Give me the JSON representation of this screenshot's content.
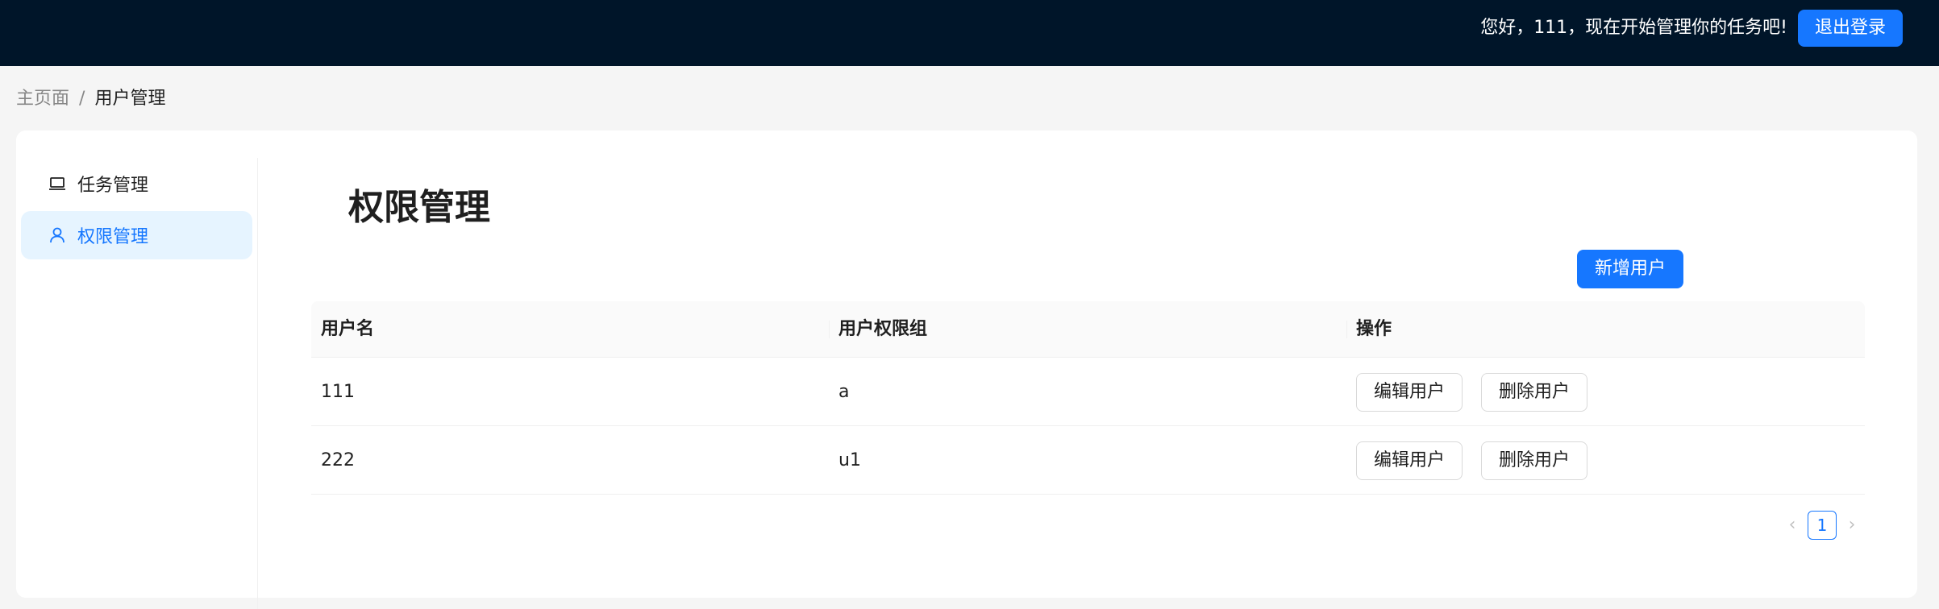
{
  "header": {
    "greeting": "您好，111，现在开始管理你的任务吧!",
    "logout_label": "退出登录"
  },
  "breadcrumb": {
    "home": "主页面",
    "separator": "/",
    "current": "用户管理"
  },
  "sidebar": {
    "items": [
      {
        "label": "任务管理",
        "icon": "laptop-icon",
        "active": false
      },
      {
        "label": "权限管理",
        "icon": "user-icon",
        "active": true
      }
    ]
  },
  "main": {
    "title": "权限管理",
    "add_user_label": "新增用户",
    "table": {
      "columns": [
        "用户名",
        "用户权限组",
        "操作"
      ],
      "rows": [
        {
          "username": "111",
          "group": "a",
          "edit": "编辑用户",
          "delete": "删除用户"
        },
        {
          "username": "222",
          "group": "u1",
          "edit": "编辑用户",
          "delete": "删除用户"
        }
      ]
    },
    "pagination": {
      "current_page": "1"
    }
  },
  "colors": {
    "header_bg": "#001529",
    "primary": "#1677ff",
    "active_menu_bg": "#e6f4ff"
  }
}
